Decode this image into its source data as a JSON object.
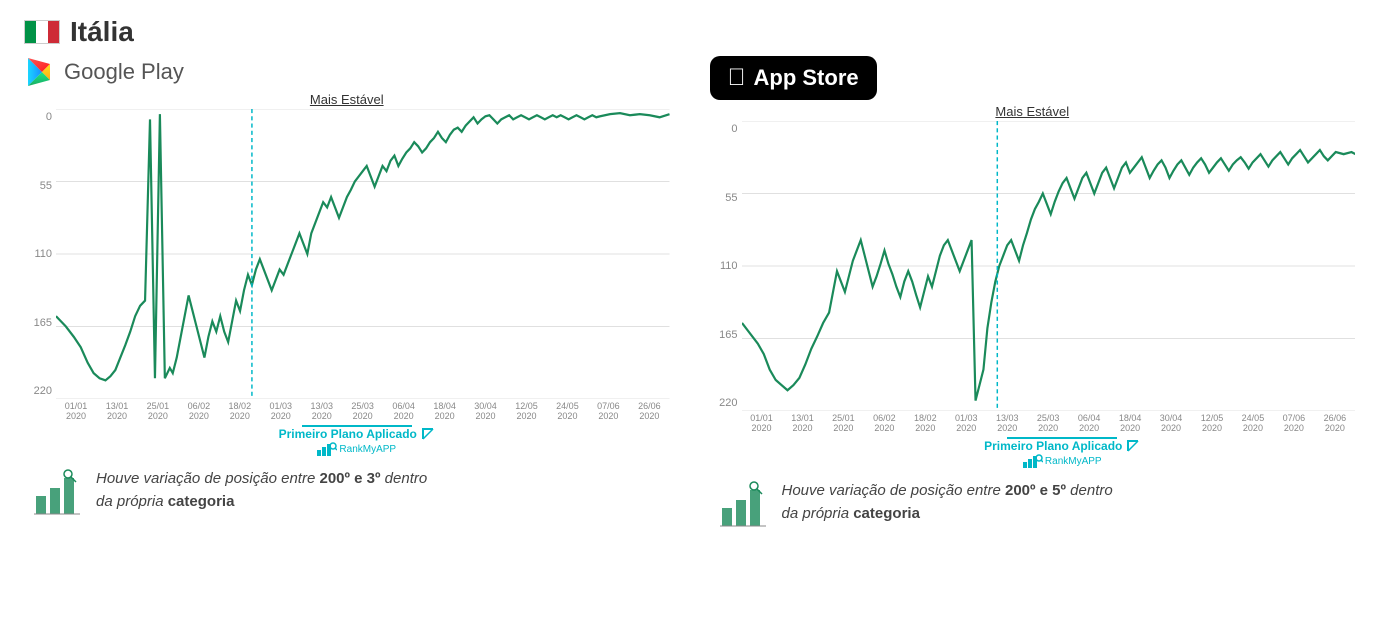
{
  "header": {
    "country": "Itália",
    "flag": {
      "stripes": [
        "#009246",
        "#fff",
        "#ce2b37"
      ]
    }
  },
  "stores": {
    "google_play": {
      "label": "Google Play"
    },
    "app_store": {
      "label": "App Store"
    }
  },
  "charts": {
    "google_play": {
      "title": "Mais Estável",
      "y_labels": [
        "0",
        "55",
        "110",
        "165",
        "220"
      ],
      "x_labels": [
        "01/01\n2020",
        "13/01\n2020",
        "25/01\n2020",
        "06/02\n2020",
        "18/02\n2020",
        "01/03\n2020",
        "13/03\n2020",
        "25/03\n2020",
        "06/04\n2020",
        "18/04\n2020",
        "30/04\n2020",
        "12/05\n2020",
        "24/05\n2020",
        "07/06\n2020",
        "26/06\n2020"
      ],
      "annotation": {
        "text": "Primeiro Plano Aplicado",
        "logo": "RankMyAPP"
      }
    },
    "app_store": {
      "title": "Mais Estável",
      "y_labels": [
        "0",
        "55",
        "110",
        "165",
        "220"
      ],
      "x_labels": [
        "01/01\n2020",
        "13/01\n2020",
        "25/01\n2020",
        "06/02\n2020",
        "18/02\n2020",
        "01/03\n2020",
        "13/03\n2020",
        "25/03\n2020",
        "06/04\n2020",
        "18/04\n2020",
        "30/04\n2020",
        "12/05\n2020",
        "24/05\n2020",
        "07/06\n2020",
        "26/06\n2020"
      ],
      "annotation": {
        "text": "Primeiro Plano Aplicado",
        "logo": "RankMyAPP"
      }
    }
  },
  "descriptions": {
    "google_play": {
      "text_before": "Houve variação de posição entre ",
      "range_start": "200º",
      "text_middle": " e ",
      "range_end": "3º",
      "text_after": " dentro da própria ",
      "category": "categoria"
    },
    "app_store": {
      "text_before": "Houve variação de posição entre ",
      "range_start": "200º",
      "text_middle": " e ",
      "range_end": "5º",
      "text_after": " dentro da própria ",
      "category": "categoria"
    }
  }
}
